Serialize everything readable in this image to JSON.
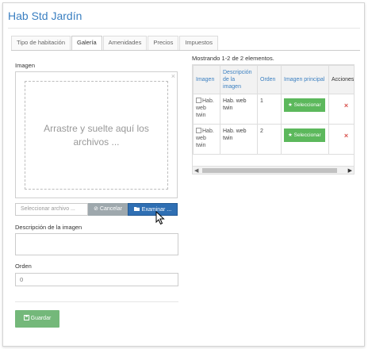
{
  "header": {
    "title": "Hab Std Jardín"
  },
  "tabs": [
    {
      "label": "Tipo de habitación",
      "active": false
    },
    {
      "label": "Galería",
      "active": true
    },
    {
      "label": "Amenidades",
      "active": false
    },
    {
      "label": "Precios",
      "active": false
    },
    {
      "label": "Impuestos",
      "active": false
    }
  ],
  "form": {
    "image_label": "Imagen",
    "dropzone_text": "Arrastre y suelte aquí los archivos ...",
    "dropzone_close": "×",
    "file_placeholder": "Seleccionar archivo ...",
    "cancel_label": "Cancelar",
    "browse_label": "Examinar ...",
    "description_label": "Descripción de la imagen",
    "description_value": "",
    "order_label": "Orden",
    "order_value": "0",
    "save_label": "Guardar"
  },
  "grid": {
    "summary": "Mostrando 1-2 de 2 elementos.",
    "columns": [
      "Imagen",
      "Descripción de la imagen",
      "Orden",
      "Imagen principal",
      "Acciones"
    ],
    "rows": [
      {
        "image_alt": "Hab. web twin",
        "description": "Hab. web twin",
        "order": "1",
        "select_label": "Seleccionar",
        "delete_icon": "×"
      },
      {
        "image_alt": "Hab. web twin",
        "description": "Hab. web twin",
        "order": "2",
        "select_label": "Seleccionar",
        "delete_icon": "×"
      }
    ]
  },
  "colors": {
    "title": "#3a7fc1",
    "browse": "#2f6fb3",
    "cancel": "#9ea8ad",
    "save": "#74b87a",
    "select": "#5cb85c",
    "delete": "#d9534f"
  }
}
